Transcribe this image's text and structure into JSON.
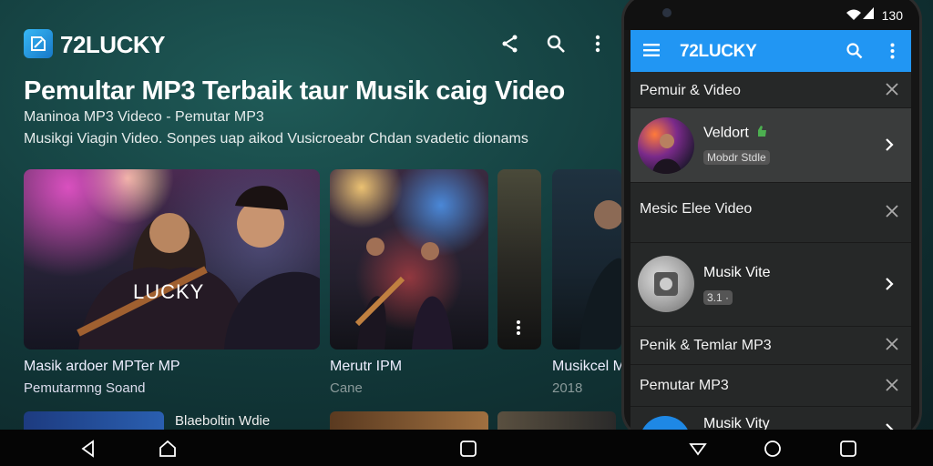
{
  "app": {
    "name": "72LUCKY",
    "headline": "Pemultar MP3 Terbaik taur Musik caig Video",
    "subtitle_line1": "Maninoa MP3 Videco - Pemutar MP3",
    "subtitle_line2": "Musikgi Viagin Video. Sonpes uap aikod Vusicroeabr Chdan svadetic dionams"
  },
  "cards": [
    {
      "title": "Masik ardoer MPTer MP",
      "sub": "Pemutarmng  Soand",
      "overlay": "LUCKY"
    },
    {
      "title": "Merutr IPM",
      "sub": "Cane"
    },
    {
      "title": "Musikcel M",
      "sub": "2018"
    }
  ],
  "row2": {
    "title": "Blaeboltin Wdie"
  },
  "phone": {
    "time": "130",
    "title": "72LUCKY",
    "sections": [
      {
        "label": "Pemuir & Video"
      },
      {
        "label": "Mesic Elee Video"
      },
      {
        "label": "Penik & Temlar MP3"
      },
      {
        "label": "Pemutar MP3"
      }
    ],
    "items": [
      {
        "title": "Veldort",
        "meta": "Mobdr Stdle"
      },
      {
        "title": "Musik Vite",
        "meta": "3.1 ·"
      },
      {
        "title": "Musik Vity"
      }
    ]
  },
  "colors": {
    "accent": "#2196f3",
    "brand": "#1e8fe0",
    "like": "#4caf50"
  },
  "icons": [
    "share-icon",
    "search-icon",
    "more-vert-icon",
    "menu-icon",
    "close-icon",
    "chevron-right-icon",
    "back-icon",
    "home-icon",
    "recents-icon"
  ]
}
